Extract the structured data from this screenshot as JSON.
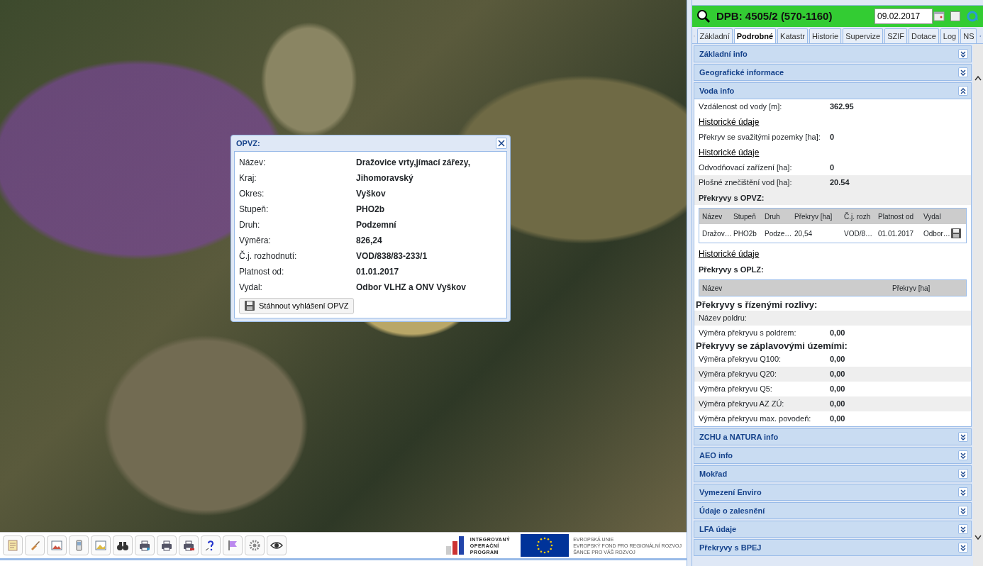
{
  "map": {
    "popup": {
      "title": "OPVZ:",
      "rows": [
        {
          "label": "Název:",
          "value": "Dražovice vrty,jímací zářezy,"
        },
        {
          "label": "Kraj:",
          "value": "Jihomoravský"
        },
        {
          "label": "Okres:",
          "value": "Vyškov"
        },
        {
          "label": "Stupeň:",
          "value": "PHO2b"
        },
        {
          "label": "Druh:",
          "value": "Podzemní"
        },
        {
          "label": "Výměra:",
          "value": "826,24"
        },
        {
          "label": "Č.j. rozhodnutí:",
          "value": "VOD/838/83-233/1"
        },
        {
          "label": "Platnost od:",
          "value": "01.01.2017"
        },
        {
          "label": "Vydal:",
          "value": "Odbor VLHZ a ONV Vyškov"
        }
      ],
      "download_button": "Stáhnout vyhlášení OPVZ"
    }
  },
  "toolbar": {
    "logos": {
      "program": [
        "INTEGROVANÝ",
        "OPERAČNÍ",
        "PROGRAM"
      ],
      "eu": [
        "EVROPSKÁ UNIE",
        "EVROPSKÝ FOND PRO REGIONÁLNÍ ROZVOJ",
        "ŠANCE PRO VÁŠ ROZVOJ"
      ]
    }
  },
  "panel": {
    "title": "DPB: 4505/2 (570-1160)",
    "date": "09.02.2017",
    "checkbox": {
      "checked": false
    },
    "tabs": [
      {
        "label": "Základní",
        "selected": false
      },
      {
        "label": "Podrobné",
        "selected": true
      },
      {
        "label": "Katastr",
        "selected": false
      },
      {
        "label": "Historie",
        "selected": false
      },
      {
        "label": "Supervize",
        "selected": false
      },
      {
        "label": "SZIF",
        "selected": false
      },
      {
        "label": "Dotace",
        "selected": false
      },
      {
        "label": "Log",
        "selected": false
      },
      {
        "label": "NS",
        "selected": false
      }
    ],
    "sections": [
      {
        "title": "Základní info",
        "expanded": false
      },
      {
        "title": "Geografické informace",
        "expanded": false
      },
      {
        "title": "Voda info",
        "expanded": true,
        "items": [
          {
            "kind": "field",
            "label": "Vzdálenost od vody [m]:",
            "value": "362.95",
            "shaded": false
          },
          {
            "kind": "link",
            "text": "Historické údaje"
          },
          {
            "kind": "field",
            "label": "Překryv se svažitými pozemky [ha]:",
            "value": "0",
            "shaded": false
          },
          {
            "kind": "link",
            "text": "Historické údaje"
          },
          {
            "kind": "field",
            "label": "Odvodňovací zařízení [ha]:",
            "value": "0",
            "shaded": false
          },
          {
            "kind": "field",
            "label": "Plošné znečištění vod [ha]:",
            "value": "20.54",
            "shaded": true
          },
          {
            "kind": "heading",
            "text": "Překryvy s OPVZ:",
            "shaded": true
          },
          {
            "kind": "table",
            "columns": [
              "Název",
              "Stupeň",
              "Druh",
              "Překryv [ha]",
              "Č.j. rozh",
              "Platnost od",
              "Vydal"
            ],
            "rows": [
              [
                "Dražov…",
                "PHO2b",
                "Podze…",
                "20,54",
                "VOD/8…",
                "01.01.2017",
                "Odbor…"
              ]
            ]
          },
          {
            "kind": "link",
            "text": "Historické údaje"
          },
          {
            "kind": "heading",
            "text": "Překryvy s OPLZ:",
            "shaded": false
          },
          {
            "kind": "table",
            "columns": [
              "Název",
              "Překryv [ha]"
            ]
          },
          {
            "kind": "group",
            "text": "Překryvy s řízenými rozlivy:"
          },
          {
            "kind": "field",
            "label": "Název poldru:",
            "shaded": true
          },
          {
            "kind": "field",
            "label": "Výměra překryvu s poldrem:",
            "value": "0,00",
            "shaded": false
          },
          {
            "kind": "group",
            "text": "Překryvy se záplavovými územími:"
          },
          {
            "kind": "field",
            "label": "Výměra překryvu Q100:",
            "value": "0,00",
            "shaded": false
          },
          {
            "kind": "field",
            "label": "Výměra překryvu Q20:",
            "value": "0,00",
            "shaded": true
          },
          {
            "kind": "field",
            "label": "Výměra překryvu Q5:",
            "value": "0,00",
            "shaded": false
          },
          {
            "kind": "field",
            "label": "Výměra překryvu AZ ZÚ:",
            "value": "0,00",
            "shaded": true
          },
          {
            "kind": "field",
            "label": "Výměra překryvu max. povodeň:",
            "value": "0,00",
            "shaded": false
          }
        ]
      },
      {
        "title": "ZCHU a NATURA info",
        "expanded": false
      },
      {
        "title": "AEO info",
        "expanded": false
      },
      {
        "title": "Mokřad",
        "expanded": false
      },
      {
        "title": "Vymezení Enviro",
        "expanded": false
      },
      {
        "title": "Údaje o zalesnění",
        "expanded": false
      },
      {
        "title": "LFA údaje",
        "expanded": false
      },
      {
        "title": "Překryvy s BPEJ",
        "expanded": false
      }
    ]
  }
}
